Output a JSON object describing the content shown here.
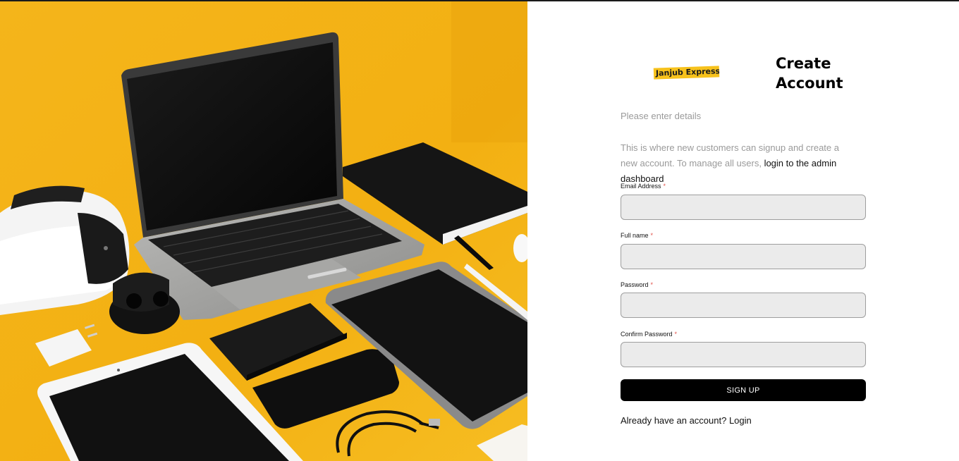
{
  "brand": {
    "logo_text": "Janjub Express",
    "accent_color": "#f7c21c"
  },
  "hero": {
    "image_description_icon": "gadgets-flatlay-image",
    "background_color": "#f3b214"
  },
  "form": {
    "title": "Create Account",
    "subtitle": "Please enter details",
    "description_prefix": "This is where new customers can signup and create a new account. To manage all users,",
    "description_link": "login to the admin dashboard",
    "fields": [
      {
        "label": "Email Address",
        "required_mark": "*",
        "value": ""
      },
      {
        "label": "Full name",
        "required_mark": "*",
        "value": ""
      },
      {
        "label": "Password",
        "required_mark": "*",
        "value": ""
      },
      {
        "label": "Confirm Password",
        "required_mark": "*",
        "value": ""
      }
    ],
    "submit_label": "SIGN UP",
    "login_prompt": "Already have an account?",
    "login_link": "Login"
  }
}
